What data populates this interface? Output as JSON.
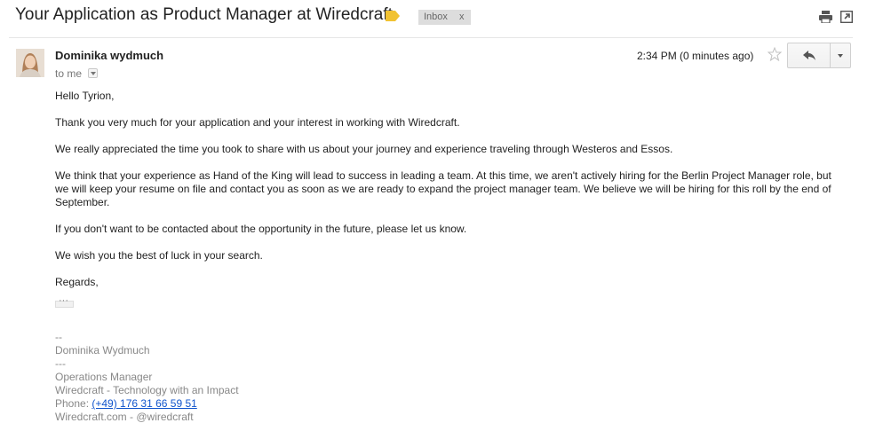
{
  "header": {
    "subject": "Your Application as Product Manager at Wiredcraft",
    "label": "Inbox",
    "label_remove": "x",
    "important_color": "#f1c232"
  },
  "message": {
    "sender_name": "Dominika wydmuch",
    "recipient": "to me",
    "timestamp": "2:34 PM (0 minutes ago)",
    "icons": [
      "label-tag-icon",
      "print-icon",
      "new-window-icon",
      "star-icon",
      "reply-icon",
      "chevron-down-icon"
    ],
    "body": {
      "greeting": "Hello Tyrion,",
      "p1": "Thank you very much for your application and your interest in working with Wiredcraft.",
      "p2": "We really appreciated the time you took to share with us about your journey and experience traveling through Westeros and Essos.",
      "p3": "We think that your experience as Hand of the King will lead to success in leading a team. At this time, we aren't actively hiring for the Berlin Project Manager role, but we will keep your resume on file and contact you as soon as we are ready to expand the project manager team. We believe we will be hiring for this roll by the end of September.",
      "p4": "If you don't want to be contacted about the opportunity in the future, please let us know.",
      "p5": "We wish you the best of luck in your search.",
      "closing": "Regards,"
    },
    "signature": {
      "sep1": "--",
      "name": "Dominika Wydmuch",
      "sep2": "---",
      "title": "Operations Manager",
      "company": "Wiredcraft - Technology with an Impact",
      "phone_label": "Phone: ",
      "phone": "(+49) 176 31 66 59 51",
      "web": "Wiredcraft.com - @wiredcraft"
    }
  }
}
